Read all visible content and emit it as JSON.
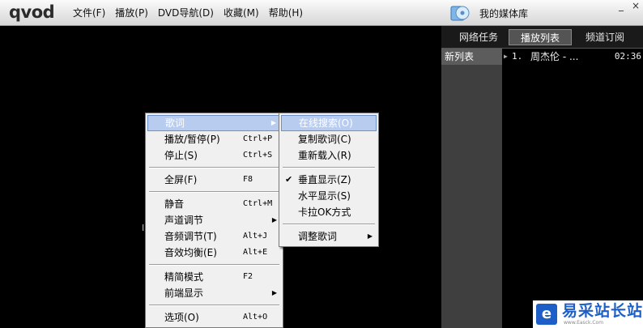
{
  "app": {
    "logo": "qvod"
  },
  "menubar": [
    {
      "label": "文件(F)"
    },
    {
      "label": "播放(P)"
    },
    {
      "label": "DVD导航(D)"
    },
    {
      "label": "收藏(M)"
    },
    {
      "label": "帮助(H)"
    }
  ],
  "media_library": {
    "label": "我的媒体库",
    "icon": "media-library-icon"
  },
  "window_controls": {
    "minimize": "_",
    "close": "×"
  },
  "tabs": [
    {
      "label": "网络任务",
      "active": false
    },
    {
      "label": "播放列表",
      "active": true
    },
    {
      "label": "频道订阅",
      "active": false
    }
  ],
  "lists": [
    {
      "label": "新列表",
      "selected": true
    }
  ],
  "playlist": [
    {
      "num": "1.",
      "title": "周杰伦 - ...",
      "time": "02:36"
    }
  ],
  "context_menu": {
    "items": [
      {
        "label": "歌词",
        "has_submenu": true,
        "highlighted": true
      },
      {
        "label": "播放/暂停(P)",
        "shortcut": "Ctrl+P"
      },
      {
        "label": "停止(S)",
        "shortcut": "Ctrl+S",
        "sep_after": true
      },
      {
        "label": "全屏(F)",
        "shortcut": "F8",
        "sep_after": true
      },
      {
        "label": "静音",
        "shortcut": "Ctrl+M"
      },
      {
        "label": "声道调节",
        "has_submenu": true
      },
      {
        "label": "音频调节(T)",
        "shortcut": "Alt+J"
      },
      {
        "label": "音效均衡(E)",
        "shortcut": "Alt+E",
        "sep_after": true
      },
      {
        "label": "精简模式",
        "shortcut": "F2"
      },
      {
        "label": "前端显示",
        "has_submenu": true,
        "sep_after": true
      },
      {
        "label": "选项(O)",
        "shortcut": "Alt+O"
      }
    ]
  },
  "lyrics_submenu": {
    "items": [
      {
        "label": "在线搜索(O)",
        "highlighted": true
      },
      {
        "label": "复制歌词(C)"
      },
      {
        "label": "重新载入(R)",
        "sep_after": true
      },
      {
        "label": "垂直显示(Z)",
        "checked": true
      },
      {
        "label": "水平显示(S)"
      },
      {
        "label": "卡拉OK方式",
        "sep_after": true
      },
      {
        "label": "调整歌词",
        "has_submenu": true
      }
    ]
  },
  "watermark": {
    "icon": "e",
    "text": "易采站长站",
    "url": "www.Easck.Com"
  },
  "colors": {
    "highlight": "#b8ccf0",
    "brand_blue": "#1d5fc7",
    "menu_bg": "#f0f0f0"
  }
}
